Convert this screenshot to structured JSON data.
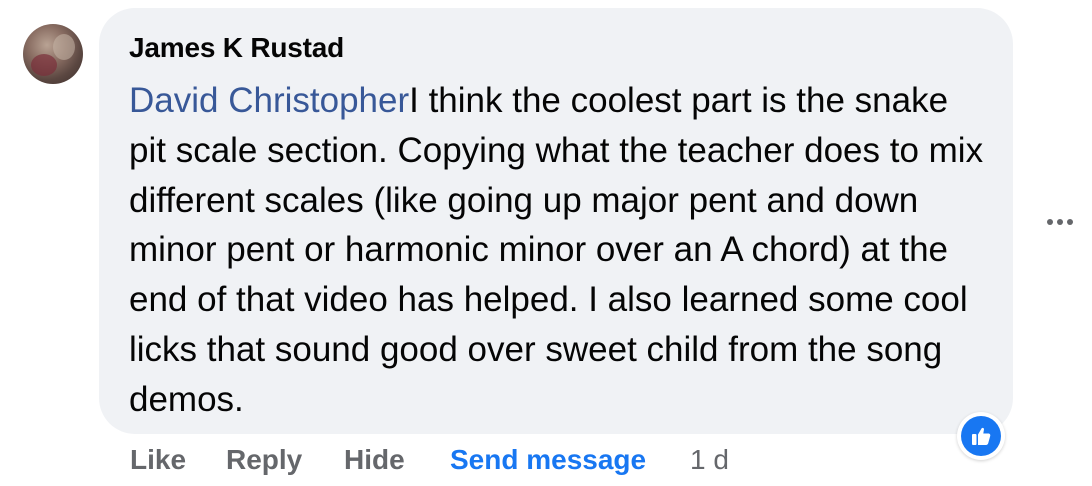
{
  "comment": {
    "author": "James K Rustad",
    "mention": "David Christopher",
    "body": "I think the coolest part is the snake pit scale section. Copying what the teacher does to mix different scales (like going up major pent and down minor pent or harmonic minor over an A chord) at the end of that video has helped. I also learned some cool licks that sound good over sweet child from the song demos."
  },
  "actions": {
    "like": "Like",
    "reply": "Reply",
    "hide": "Hide",
    "send_message": "Send message",
    "timestamp": "1 d"
  },
  "icons": {
    "more": "more-options-icon",
    "reaction": "thumbs-up-icon"
  },
  "colors": {
    "bubble": "#f0f2f5",
    "mention": "#385898",
    "accent": "#1877f2",
    "secondary_text": "#65676b"
  }
}
